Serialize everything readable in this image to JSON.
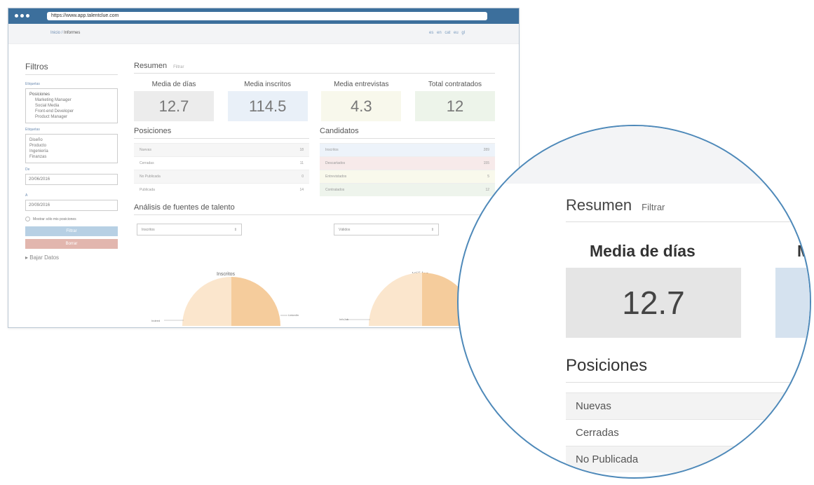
{
  "browser": {
    "url": "https://www.app.talentclue.com",
    "breadcrumb_home": "Inicio /",
    "breadcrumb_current": "Informes",
    "languages": "es en cat eu gl"
  },
  "sidebar": {
    "title": "Filtros",
    "label1": "Etiquetas",
    "positions_head": "Posiciones",
    "positions": [
      "Marketing Manager",
      "Social Media",
      "Front-end Developer",
      "Product Manager"
    ],
    "label2": "Etiquetas",
    "departments": [
      "Diseño",
      "Producto",
      "Ingeniería",
      "Finanzas"
    ],
    "from_label": "De",
    "from_value": "20/06/2016",
    "to_label": "A",
    "to_value": "20/09/2016",
    "checkbox_label": "Mostrar sólo mis posiciones",
    "filter_button": "Filtrar",
    "clear_button": "Borrar",
    "download": "▸ Bajar Datos"
  },
  "summary": {
    "title": "Resumen",
    "filter_link": "Filtrar",
    "stats": [
      {
        "label": "Media de días",
        "value": "12.7",
        "color": "#ececec"
      },
      {
        "label": "Media inscritos",
        "value": "114.5",
        "color": "#e9f0f8"
      },
      {
        "label": "Media entrevistas",
        "value": "4.3",
        "color": "#f8f8ec"
      },
      {
        "label": "Total contratados",
        "value": "12",
        "color": "#edf4ea"
      }
    ]
  },
  "positions": {
    "title": "Posiciones",
    "rows": [
      {
        "label": "Nuevas",
        "value": "18"
      },
      {
        "label": "Cerradas",
        "value": "11"
      },
      {
        "label": "No Publicada",
        "value": "0"
      },
      {
        "label": "Publicada",
        "value": "14"
      }
    ]
  },
  "candidates": {
    "title": "Candidatos",
    "rows": [
      {
        "label": "Inscritos",
        "value": "289",
        "color": "#edf3fa"
      },
      {
        "label": "Descartados",
        "value": "155",
        "color": "#f7eaea"
      },
      {
        "label": "Entrevistados",
        "value": "5",
        "color": "#f9f9ec"
      },
      {
        "label": "Contratados",
        "value": "12",
        "color": "#eef4ec"
      }
    ]
  },
  "analysis": {
    "title": "Análisis de fuentes de talento",
    "select1": "Inscritos",
    "select2": "Válidos",
    "chart1_title": "Inscritos",
    "chart2_title": "Válidos",
    "chart1_left_label": "Indeed",
    "chart1_right_label": "LinkedIn",
    "chart2_left_label": "InfoJob",
    "pie_colors": [
      "#fbe6cd",
      "#f5cc9c"
    ]
  },
  "magnifier": {
    "resumen": "Resumen",
    "filtrar": "Filtrar",
    "stat_label": "Media de días",
    "stat_label_cut": "M",
    "stat_value": "12.7",
    "positions_title": "Posiciones",
    "rows": [
      "Nuevas",
      "Cerradas",
      "No Publicada"
    ]
  }
}
